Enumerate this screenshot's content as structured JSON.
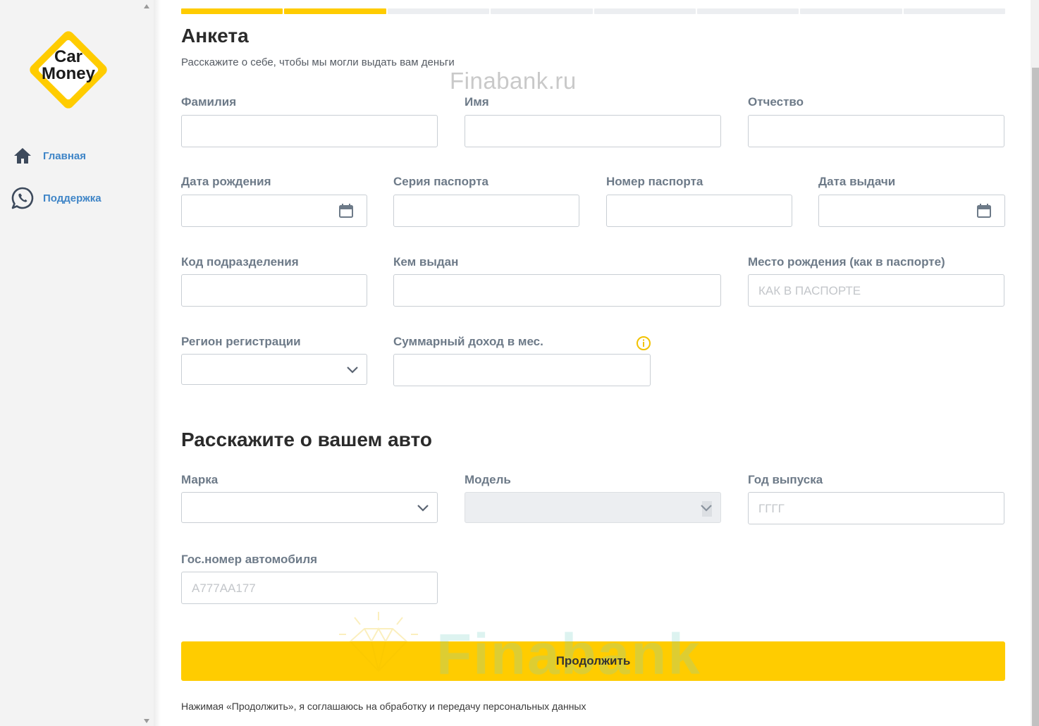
{
  "sidebar": {
    "logo": {
      "line1": "Car",
      "line2": "Money",
      "color": "#ffcc00"
    },
    "items": [
      {
        "label": "Главная",
        "icon": "home-icon"
      },
      {
        "label": "Поддержка",
        "icon": "whatsapp-icon"
      }
    ]
  },
  "progress": {
    "total_steps": 8,
    "completed_steps": 2,
    "accent": "#ffcc00"
  },
  "form": {
    "title": "Анкета",
    "subtitle": "Расскажите о себе, чтобы мы могли выдать вам деньги",
    "watermark": "Finabank.ru",
    "fields": {
      "last_name": {
        "label": "Фамилия",
        "value": ""
      },
      "first_name": {
        "label": "Имя",
        "value": ""
      },
      "patronymic": {
        "label": "Отчество",
        "value": ""
      },
      "birth_date": {
        "label": "Дата рождения",
        "value": ""
      },
      "passport_series": {
        "label": "Серия паспорта",
        "value": ""
      },
      "passport_number": {
        "label": "Номер паспорта",
        "value": ""
      },
      "issue_date": {
        "label": "Дата выдачи",
        "value": ""
      },
      "department_code": {
        "label": "Код подразделения",
        "value": ""
      },
      "issued_by": {
        "label": "Кем выдан",
        "value": ""
      },
      "birth_place": {
        "label": "Место рождения (как в паспорте)",
        "placeholder": "КАК В ПАСПОРТЕ"
      },
      "region": {
        "label": "Регион регистрации",
        "value": ""
      },
      "income": {
        "label": "Суммарный доход в мес.",
        "value": ""
      }
    }
  },
  "car": {
    "title": "Расскажите о вашем авто",
    "fields": {
      "brand": {
        "label": "Марка",
        "value": ""
      },
      "model": {
        "label": "Модель",
        "value": ""
      },
      "year": {
        "label": "Год выпуска",
        "placeholder": "ГГГГ"
      },
      "plate": {
        "label": "Гос.номер автомобиля",
        "placeholder": "А777АА177"
      }
    }
  },
  "actions": {
    "continue_label": "Продолжить",
    "consent": "Нажимая «Продолжить», я соглашаюсь на обработку и передачу персональных данных",
    "watermark": "Finabank"
  }
}
